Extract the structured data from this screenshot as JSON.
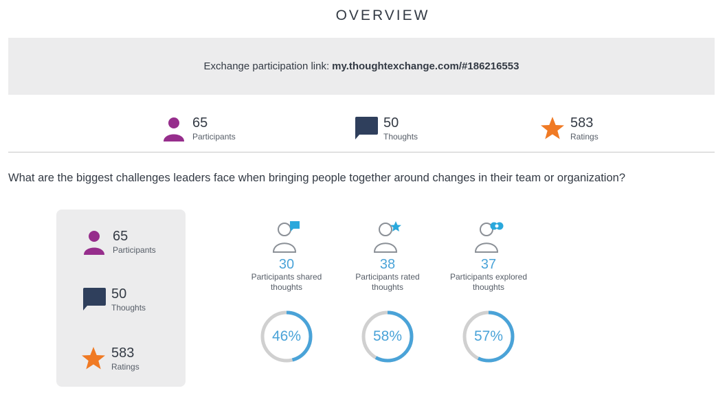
{
  "header": {
    "title": "OVERVIEW"
  },
  "link_bar": {
    "prefix": "Exchange participation link:",
    "link": "my.thoughtexchange.com/#186216553"
  },
  "top_stats": [
    {
      "value": "65",
      "label": "Participants",
      "icon": "person-icon"
    },
    {
      "value": "50",
      "label": "Thoughts",
      "icon": "speech-bubble-icon"
    },
    {
      "value": "583",
      "label": "Ratings",
      "icon": "star-icon"
    }
  ],
  "question": "What are the biggest challenges leaders face when bringing people together around changes in their team or organization?",
  "side_stats": [
    {
      "value": "65",
      "label": "Participants",
      "icon": "person-icon"
    },
    {
      "value": "50",
      "label": "Thoughts",
      "icon": "speech-bubble-icon"
    },
    {
      "value": "583",
      "label": "Ratings",
      "icon": "star-icon"
    }
  ],
  "metrics": [
    {
      "value": "30",
      "label_line1": "Participants shared",
      "label_line2": "thoughts",
      "percent_text": "46%",
      "percent": 46,
      "icon": "person-shared-icon"
    },
    {
      "value": "38",
      "label_line1": "Participants rated",
      "label_line2": "thoughts",
      "percent_text": "58%",
      "percent": 58,
      "icon": "person-rated-icon"
    },
    {
      "value": "37",
      "label_line1": "Participants explored",
      "label_line2": "thoughts",
      "percent_text": "57%",
      "percent": 57,
      "icon": "person-explored-icon"
    }
  ],
  "colors": {
    "participants": "#962e8c",
    "thoughts": "#2f3f5c",
    "ratings": "#f07a24",
    "accent": "#4aa3d8",
    "ring_track": "#d0d0d0"
  }
}
